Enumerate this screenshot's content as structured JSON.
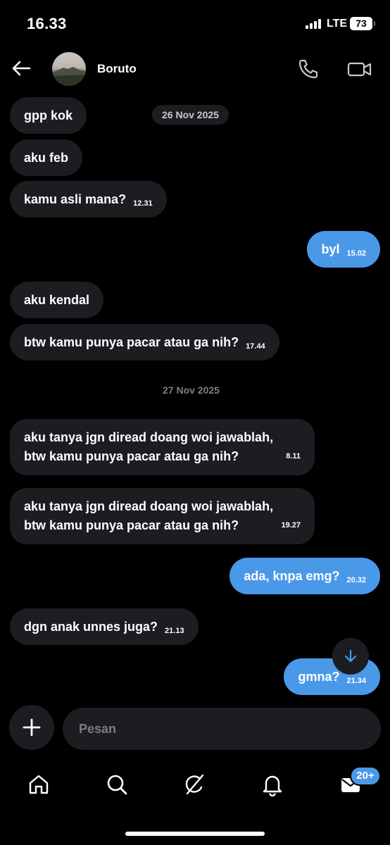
{
  "status": {
    "time": "16.33",
    "network": "LTE",
    "battery": "73"
  },
  "header": {
    "contact_name": "Boruto"
  },
  "dates": [
    "26 Nov 2025",
    "27 Nov 2025"
  ],
  "messages": [
    {
      "text": "gpp kok",
      "time": ""
    },
    {
      "text": "aku feb",
      "time": ""
    },
    {
      "text": "kamu asli mana?",
      "time": "12.31"
    },
    {
      "text": "byl",
      "time": "15.02"
    },
    {
      "text": "aku kendal",
      "time": ""
    },
    {
      "text": "btw kamu punya pacar atau ga nih?",
      "time": "17.44"
    },
    {
      "line1": "aku tanya jgn diread doang woi jawablah,",
      "line2": "btw kamu punya pacar atau ga nih?",
      "time": "8.11"
    },
    {
      "line1": "aku tanya jgn diread doang woi jawablah,",
      "line2": "btw kamu punya pacar atau ga nih?",
      "time": "19.27"
    },
    {
      "text": "ada, knpa emg?",
      "time": "20.32"
    },
    {
      "text": "dgn anak unnes juga?",
      "time": "21.13"
    },
    {
      "text": "gmna?",
      "time": "21.34"
    }
  ],
  "compose": {
    "placeholder": "Pesan"
  },
  "tabbar": {
    "items": [
      "home-icon",
      "search-icon",
      "grok-icon",
      "bell-icon",
      "mail-icon"
    ],
    "mail_badge": "20+"
  },
  "colors": {
    "background": "#000000",
    "received_bubble": "#1c1d20",
    "sent_bubble": "#4a99e9"
  }
}
